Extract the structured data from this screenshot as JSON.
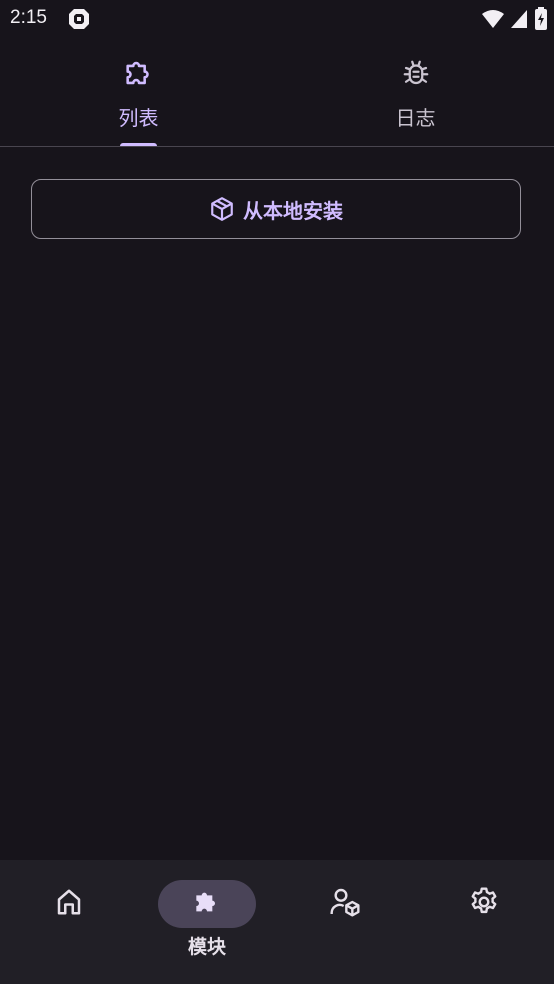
{
  "status_bar": {
    "time": "2:15"
  },
  "tabs": [
    {
      "label": "列表",
      "icon": "puzzle-outline-icon",
      "selected": true
    },
    {
      "label": "日志",
      "icon": "bug-icon",
      "selected": false
    }
  ],
  "install_button": {
    "label": "从本地安装",
    "icon": "package-icon"
  },
  "bottom_nav": [
    {
      "icon": "home-icon",
      "label": "",
      "selected": false
    },
    {
      "icon": "puzzle-icon",
      "label": "模块",
      "selected": true
    },
    {
      "icon": "user-package-icon",
      "label": "",
      "selected": false
    },
    {
      "icon": "gear-icon",
      "label": "",
      "selected": false
    }
  ],
  "colors": {
    "accent": "#d0bcff",
    "background": "#17141b",
    "nav_background": "#211f26",
    "indicator_pill": "#4a4458"
  }
}
